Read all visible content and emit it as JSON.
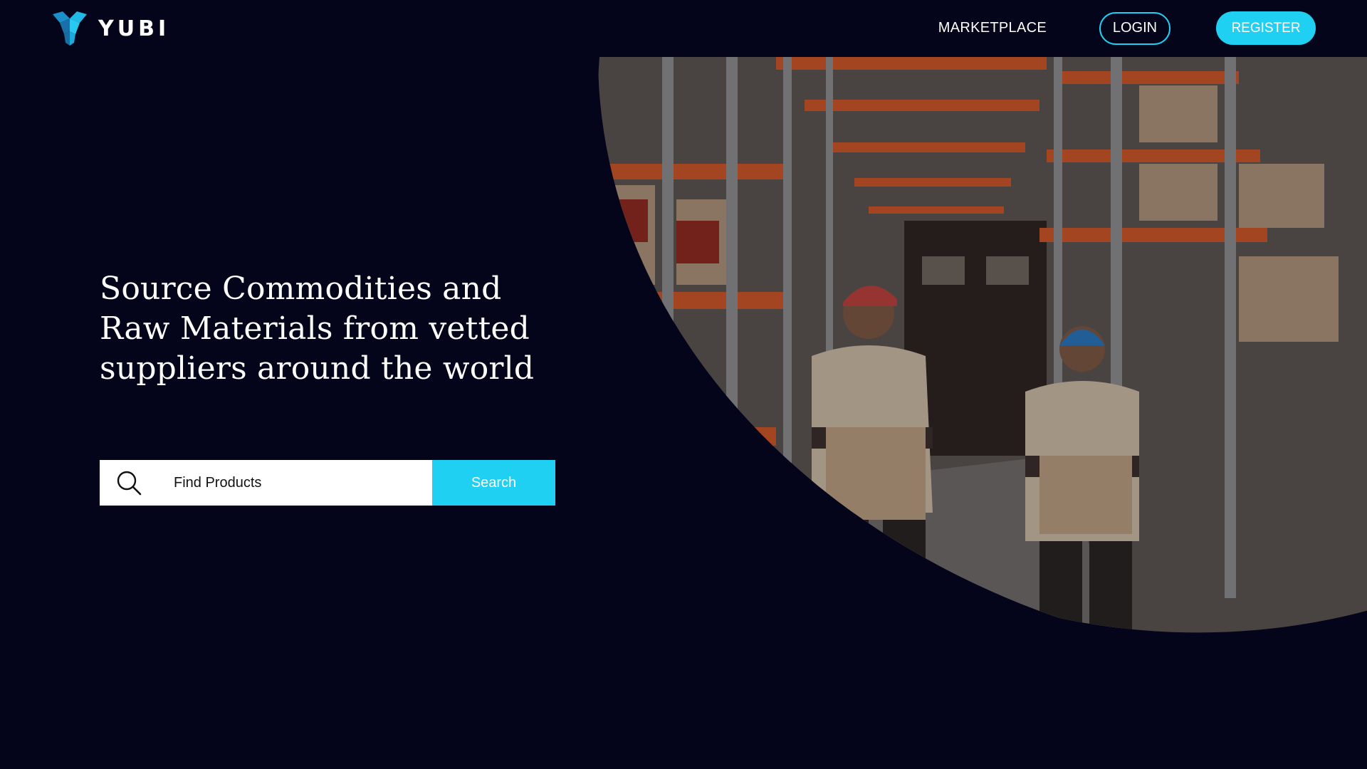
{
  "brand": {
    "name": "YUBI",
    "logo_icon": "yubi-logo-icon",
    "accent": "#1fd0f3",
    "background": "#04051a"
  },
  "nav": {
    "marketplace": "MARKETPLACE",
    "login": "LOGIN",
    "register": "REGISTER"
  },
  "hero": {
    "headline": "Source Commodities and Raw Materials from vetted suppliers around the world",
    "image": "warehouse-workers-photo"
  },
  "search": {
    "placeholder": "Find Products",
    "value": "",
    "button_label": "Search",
    "icon": "search-icon"
  }
}
